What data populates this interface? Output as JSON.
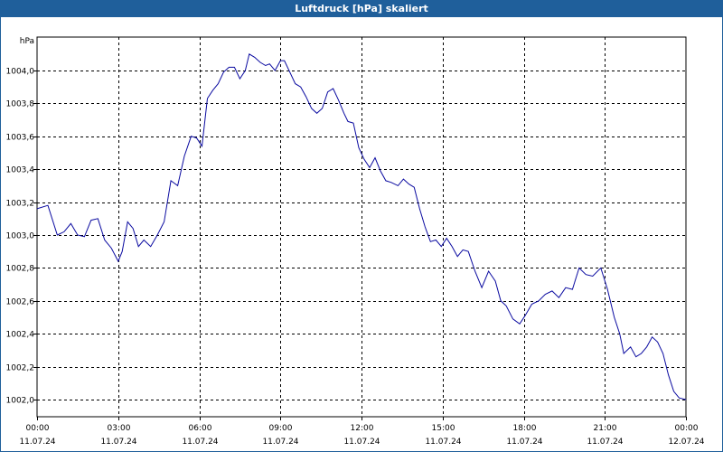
{
  "window": {
    "title": "Luftdruck [hPa] skaliert"
  },
  "colors": {
    "title_bar": "#1f5f9b",
    "series": "#0a0aa0",
    "grid": "#000000"
  },
  "chart_data": {
    "type": "line",
    "title": "Luftdruck [hPa] skaliert",
    "ylabel": "hPa",
    "xlabel": "",
    "grid": true,
    "ylim": [
      1001.92,
      1004.1
    ],
    "y_ticks": [
      "1004,0",
      "1003,8",
      "1003,6",
      "1003,4",
      "1003,2",
      "1003,0",
      "1002,8",
      "1002,6",
      "1002,4",
      "1002,2",
      "1002,0"
    ],
    "y_tick_values": [
      1004.0,
      1003.8,
      1003.6,
      1003.4,
      1003.2,
      1003.0,
      1002.8,
      1002.6,
      1002.4,
      1002.2,
      1002.0
    ],
    "x_ticks": [
      {
        "time": "00:00",
        "date": "11.07.24"
      },
      {
        "time": "03:00",
        "date": "11.07.24"
      },
      {
        "time": "06:00",
        "date": "11.07.24"
      },
      {
        "time": "09:00",
        "date": "11.07.24"
      },
      {
        "time": "12:00",
        "date": "11.07.24"
      },
      {
        "time": "15:00",
        "date": "11.07.24"
      },
      {
        "time": "18:00",
        "date": "11.07.24"
      },
      {
        "time": "21:00",
        "date": "11.07.24"
      },
      {
        "time": "00:00",
        "date": "12.07.24"
      }
    ],
    "xlim_hours": [
      0,
      24
    ],
    "series": [
      {
        "x_hours": [
          0.0,
          0.4,
          0.75,
          1.0,
          1.25,
          1.5,
          1.75,
          2.0,
          2.25,
          2.5,
          2.75,
          3.0,
          3.15,
          3.35,
          3.55,
          3.75,
          3.95,
          4.2,
          4.45,
          4.7,
          4.95,
          5.2,
          5.45,
          5.7,
          5.9,
          6.1,
          6.3,
          6.5,
          6.7,
          6.9,
          7.1,
          7.3,
          7.5,
          7.7,
          7.85,
          8.05,
          8.25,
          8.45,
          8.6,
          8.8,
          9.0,
          9.15,
          9.35,
          9.55,
          9.75,
          9.95,
          10.15,
          10.35,
          10.55,
          10.75,
          10.95,
          11.15,
          11.35,
          11.5,
          11.7,
          11.9,
          12.1,
          12.3,
          12.5,
          12.7,
          12.9,
          13.1,
          13.35,
          13.55,
          13.75,
          13.95,
          14.15,
          14.35,
          14.55,
          14.75,
          14.95,
          15.15,
          15.35,
          15.55,
          15.75,
          15.95,
          16.2,
          16.45,
          16.7,
          16.95,
          17.15,
          17.35,
          17.6,
          17.85,
          18.05,
          18.3,
          18.55,
          18.8,
          19.05,
          19.3,
          19.55,
          19.8,
          20.05,
          20.3,
          20.55,
          20.85,
          21.1,
          21.35,
          21.55,
          21.7,
          21.95,
          22.15,
          22.35,
          22.55,
          22.75,
          22.95,
          23.15,
          23.35,
          23.55,
          23.75,
          24.0
        ],
        "values": [
          1003.16,
          1003.18,
          1003.0,
          1003.02,
          1003.07,
          1003.0,
          1002.99,
          1003.09,
          1003.1,
          1002.97,
          1002.92,
          1002.84,
          1002.9,
          1003.08,
          1003.04,
          1002.93,
          1002.97,
          1002.93,
          1003.0,
          1003.08,
          1003.33,
          1003.3,
          1003.48,
          1003.6,
          1003.59,
          1003.54,
          1003.83,
          1003.88,
          1003.92,
          1003.99,
          1004.02,
          1004.02,
          1003.95,
          1004.0,
          1004.1,
          1004.08,
          1004.05,
          1004.03,
          1004.04,
          1004.0,
          1004.06,
          1004.06,
          1003.99,
          1003.92,
          1003.9,
          1003.84,
          1003.77,
          1003.74,
          1003.77,
          1003.87,
          1003.89,
          1003.82,
          1003.74,
          1003.69,
          1003.68,
          1003.53,
          1003.46,
          1003.41,
          1003.47,
          1003.39,
          1003.33,
          1003.32,
          1003.3,
          1003.34,
          1003.31,
          1003.29,
          1003.16,
          1003.05,
          1002.96,
          1002.97,
          1002.93,
          1002.98,
          1002.93,
          1002.87,
          1002.91,
          1002.9,
          1002.78,
          1002.68,
          1002.78,
          1002.72,
          1002.6,
          1002.57,
          1002.49,
          1002.46,
          1002.51,
          1002.58,
          1002.6,
          1002.64,
          1002.66,
          1002.62,
          1002.68,
          1002.67,
          1002.8,
          1002.76,
          1002.75,
          1002.8,
          1002.67,
          1002.5,
          1002.4,
          1002.28,
          1002.32,
          1002.26,
          1002.28,
          1002.32,
          1002.38,
          1002.35,
          1002.28,
          1002.15,
          1002.05,
          1002.01,
          1002.0
        ]
      }
    ]
  }
}
